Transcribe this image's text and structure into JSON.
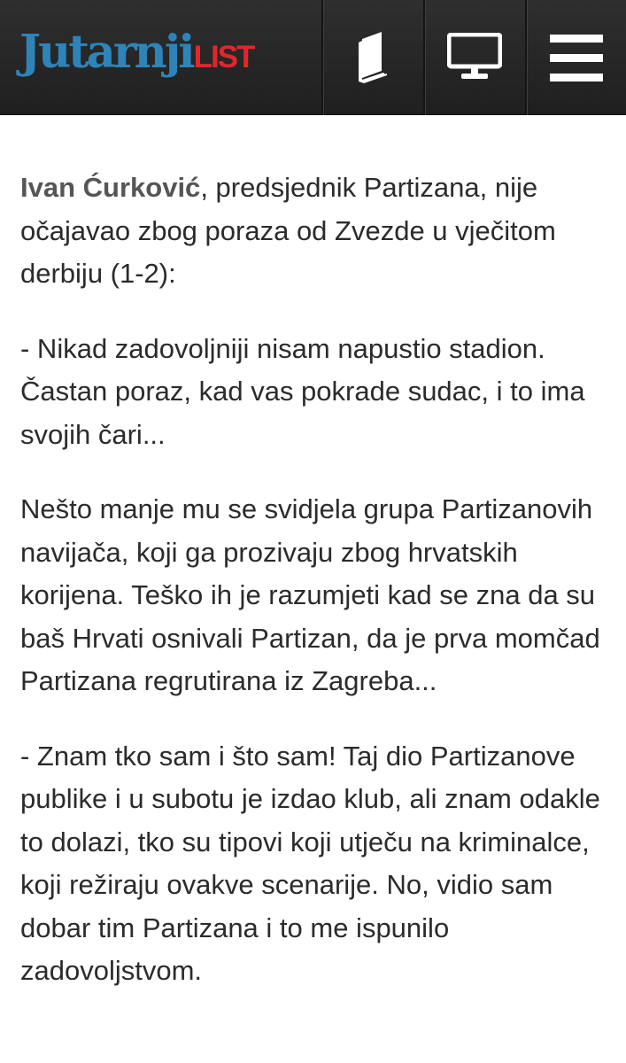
{
  "header": {
    "logo_main": "Jutarnji",
    "logo_suffix": "LIST",
    "brand_blue": "#2e84b8",
    "brand_red": "#e2262c",
    "buttons": [
      {
        "icon": "magazine-icon"
      },
      {
        "icon": "desktop-icon"
      },
      {
        "icon": "menu-icon"
      }
    ]
  },
  "article": {
    "intro_author": "Ivan Ćurković",
    "intro_text": ", predsjednik Partizana, nije očajavao zbog poraza od Zvezde u vječitom derbiju (1-2):",
    "paragraph_2": "- Nikad zadovoljniji nisam napustio stadion. Častan poraz, kad vas pokrade sudac, i to ima svojih čari...",
    "paragraph_3": "Nešto manje mu se svidjela grupa Partizanovih navijača, koji ga prozivaju zbog hrvatskih korijena. Teško ih je razumjeti kad se zna da su baš Hrvati osnivali Partizan, da je prva momčad Partizana regrutirana iz Zagreba...",
    "paragraph_4": "- Znam tko sam i što sam! Taj dio Partizanove publike i u subotu je izdao klub, ali znam odakle to dolazi, tko su tipovi koji utječu na kriminalce, koji režiraju ovakve scenarije. No, vidio sam dobar tim Partizana i to me ispunilo zadovoljstvom."
  }
}
